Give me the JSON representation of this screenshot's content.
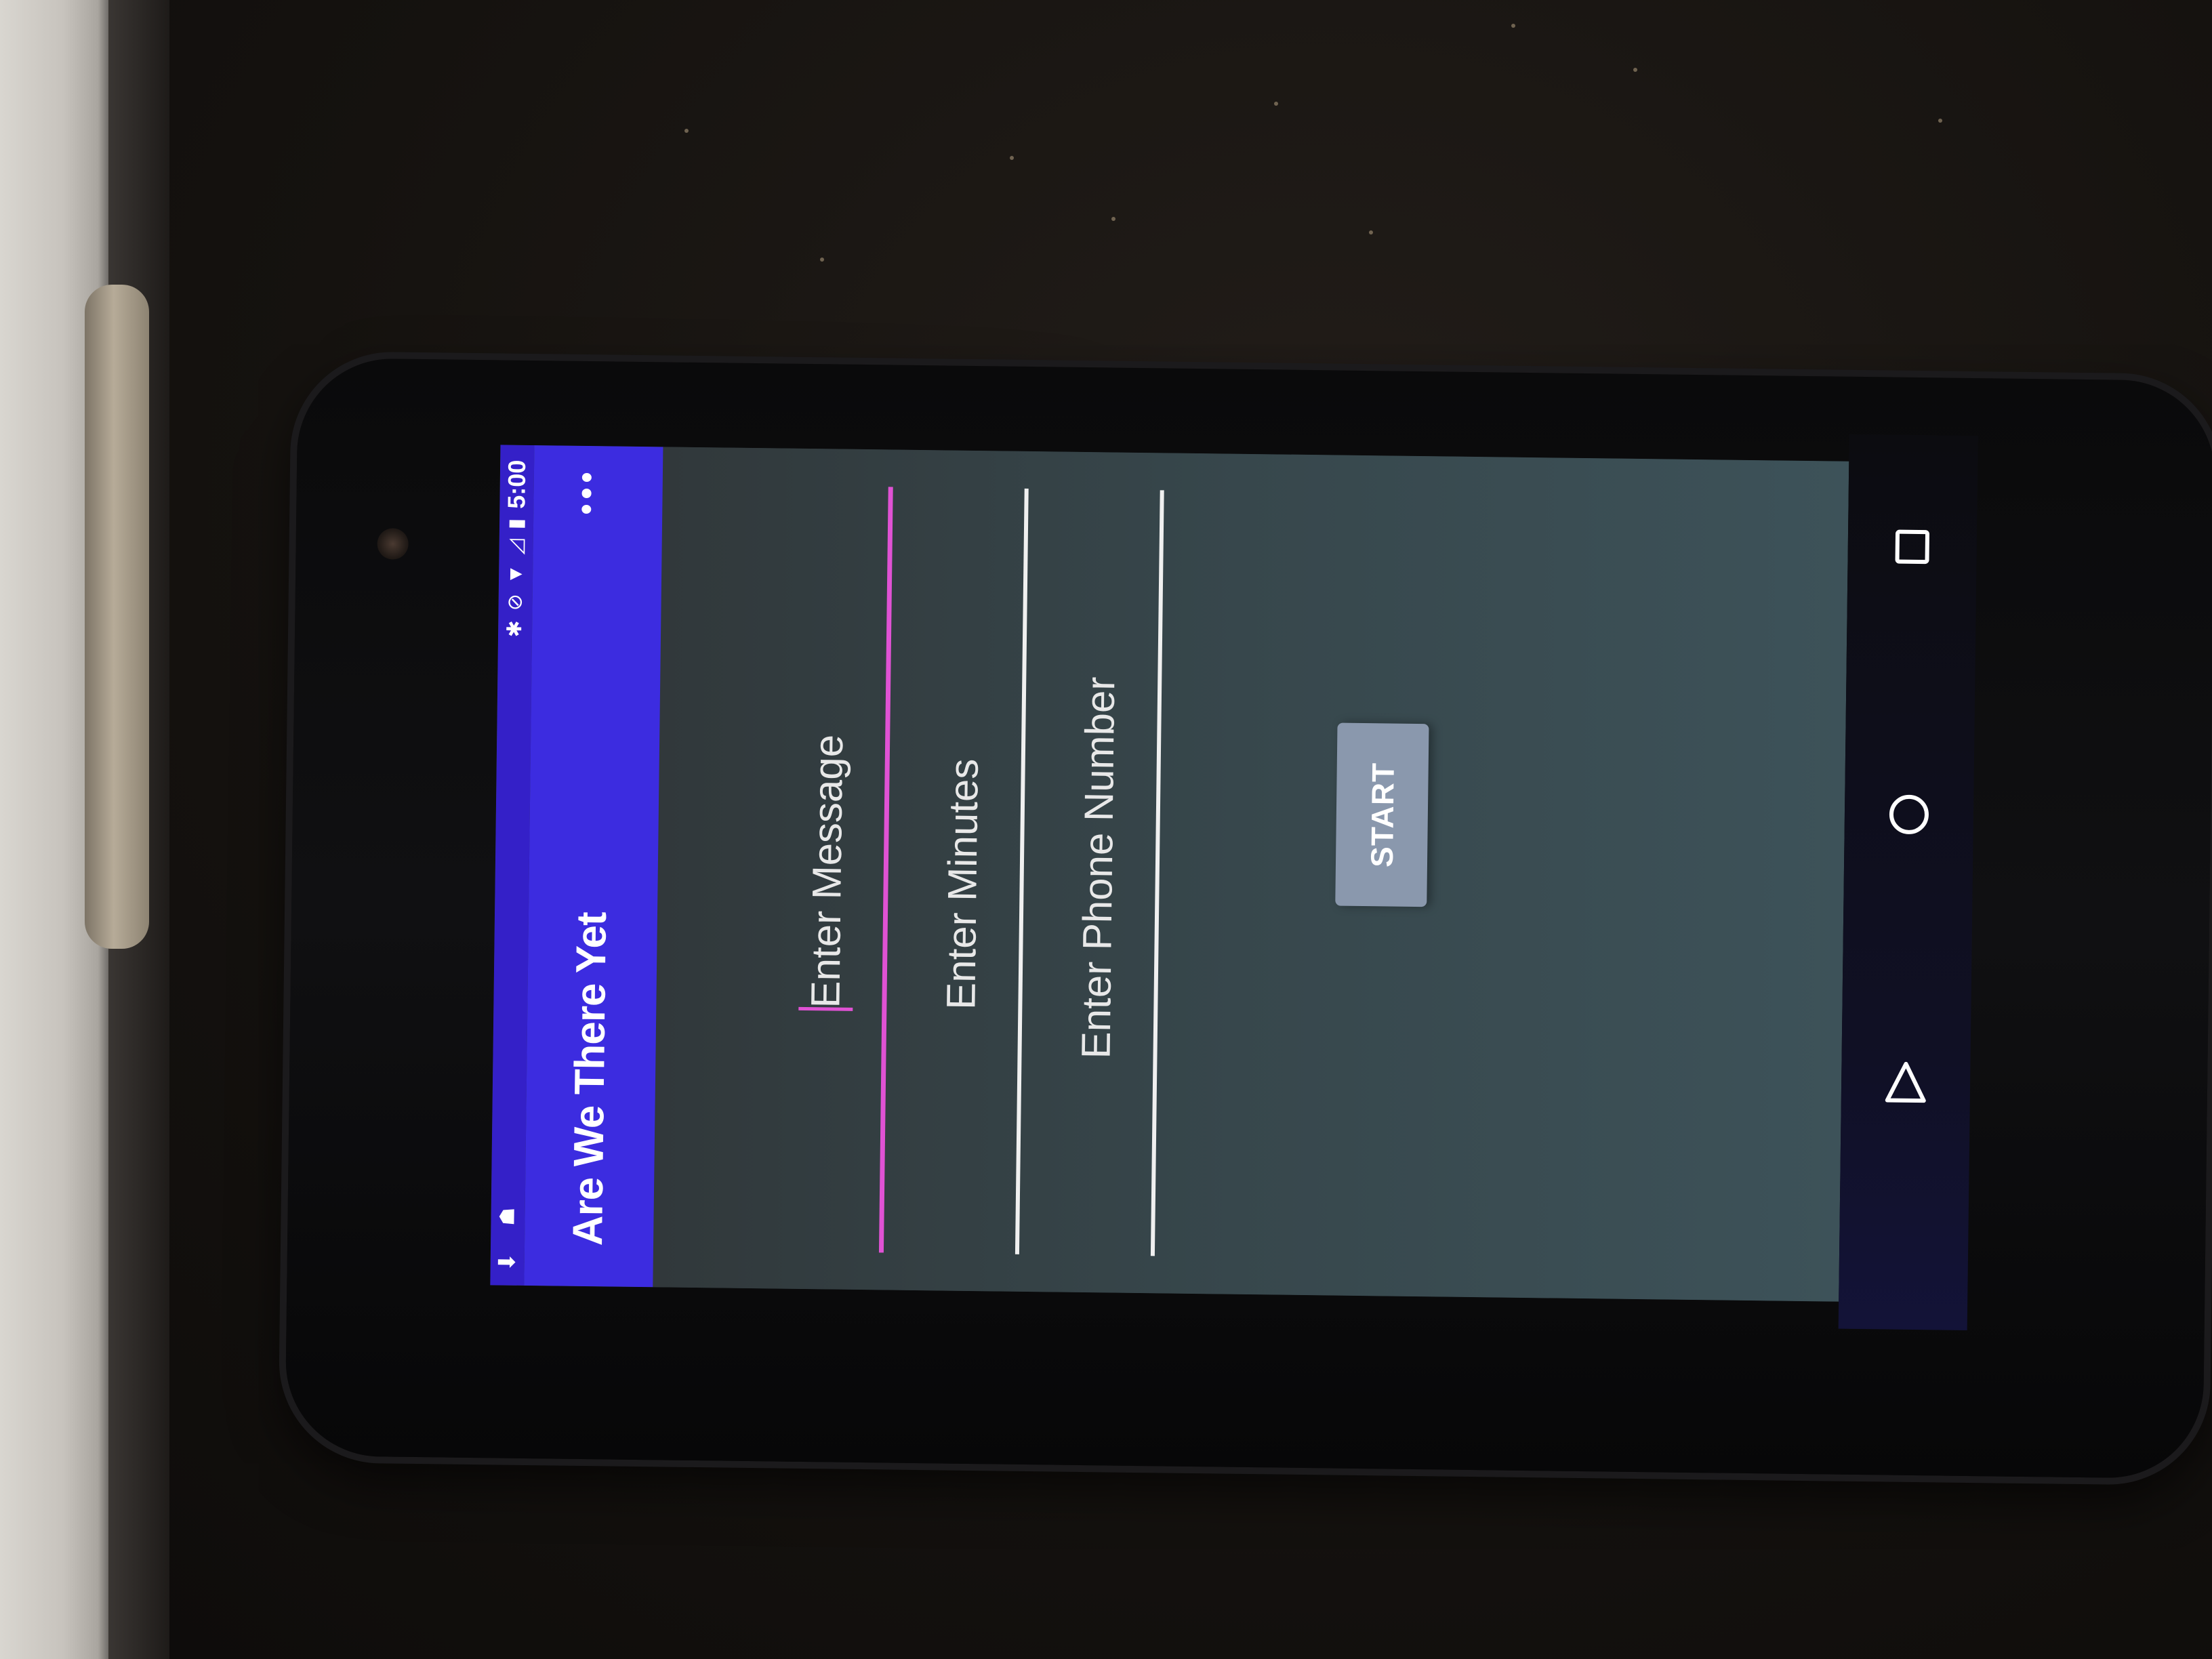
{
  "status_bar": {
    "time": "5:00"
  },
  "app_bar": {
    "title": "Are We There Yet",
    "overflow_icon": "more-vert-icon"
  },
  "form": {
    "message": {
      "placeholder": "Enter Message",
      "value": ""
    },
    "minutes": {
      "placeholder": "Enter Minutes",
      "value": ""
    },
    "phone": {
      "placeholder": "Enter Phone Number",
      "value": ""
    },
    "start_label": "START"
  },
  "colors": {
    "app_bar": "#3c2ce0",
    "accent": "#e052d4",
    "button": "#8a98ad"
  },
  "nav_bar": {
    "items": [
      "back-icon",
      "home-icon",
      "recents-icon"
    ]
  }
}
